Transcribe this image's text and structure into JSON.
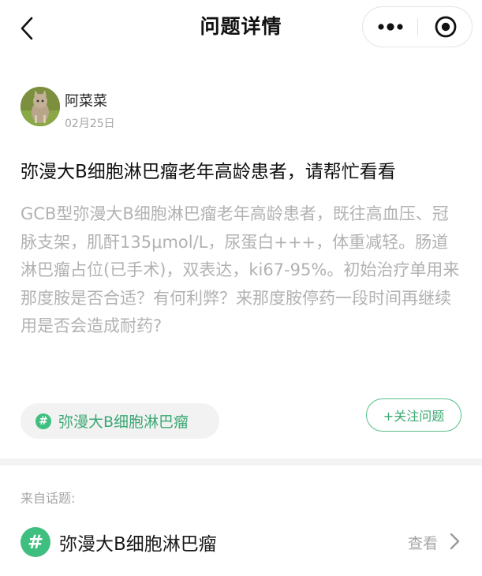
{
  "nav": {
    "title": "问题详情",
    "back_icon": "chevron-left-icon",
    "more_icon": "more-dots-icon",
    "close_icon": "target-circle-icon"
  },
  "author": {
    "name": "阿菜菜",
    "date": "02月25日"
  },
  "question": {
    "title": "弥漫大B细胞淋巴瘤老年高龄患者，请帮忙看看",
    "body": "GCB型弥漫大B细胞淋巴瘤老年高龄患者，既往高血压、冠脉支架，肌酐135μmol/L，尿蛋白+++，体重减轻。肠道淋巴瘤占位(已手术)，双表达，ki67-95%。初始治疗单用来那度胺是否合适？有何利弊？来那度胺停药一段时间再继续用是否会造成耐药?"
  },
  "tag": {
    "symbol": "#",
    "label": "弥漫大B细胞淋巴瘤"
  },
  "follow_button": "+关注问题",
  "from_topic": {
    "label": "来自话题:",
    "symbol": "#",
    "name": "弥漫大B细胞淋巴瘤",
    "view_label": "查看"
  },
  "colors": {
    "accent_green": "#3fbf7f",
    "tag_text": "#3aa873",
    "muted_text": "#a6a6a6",
    "body_text": "#b2b2b2"
  }
}
